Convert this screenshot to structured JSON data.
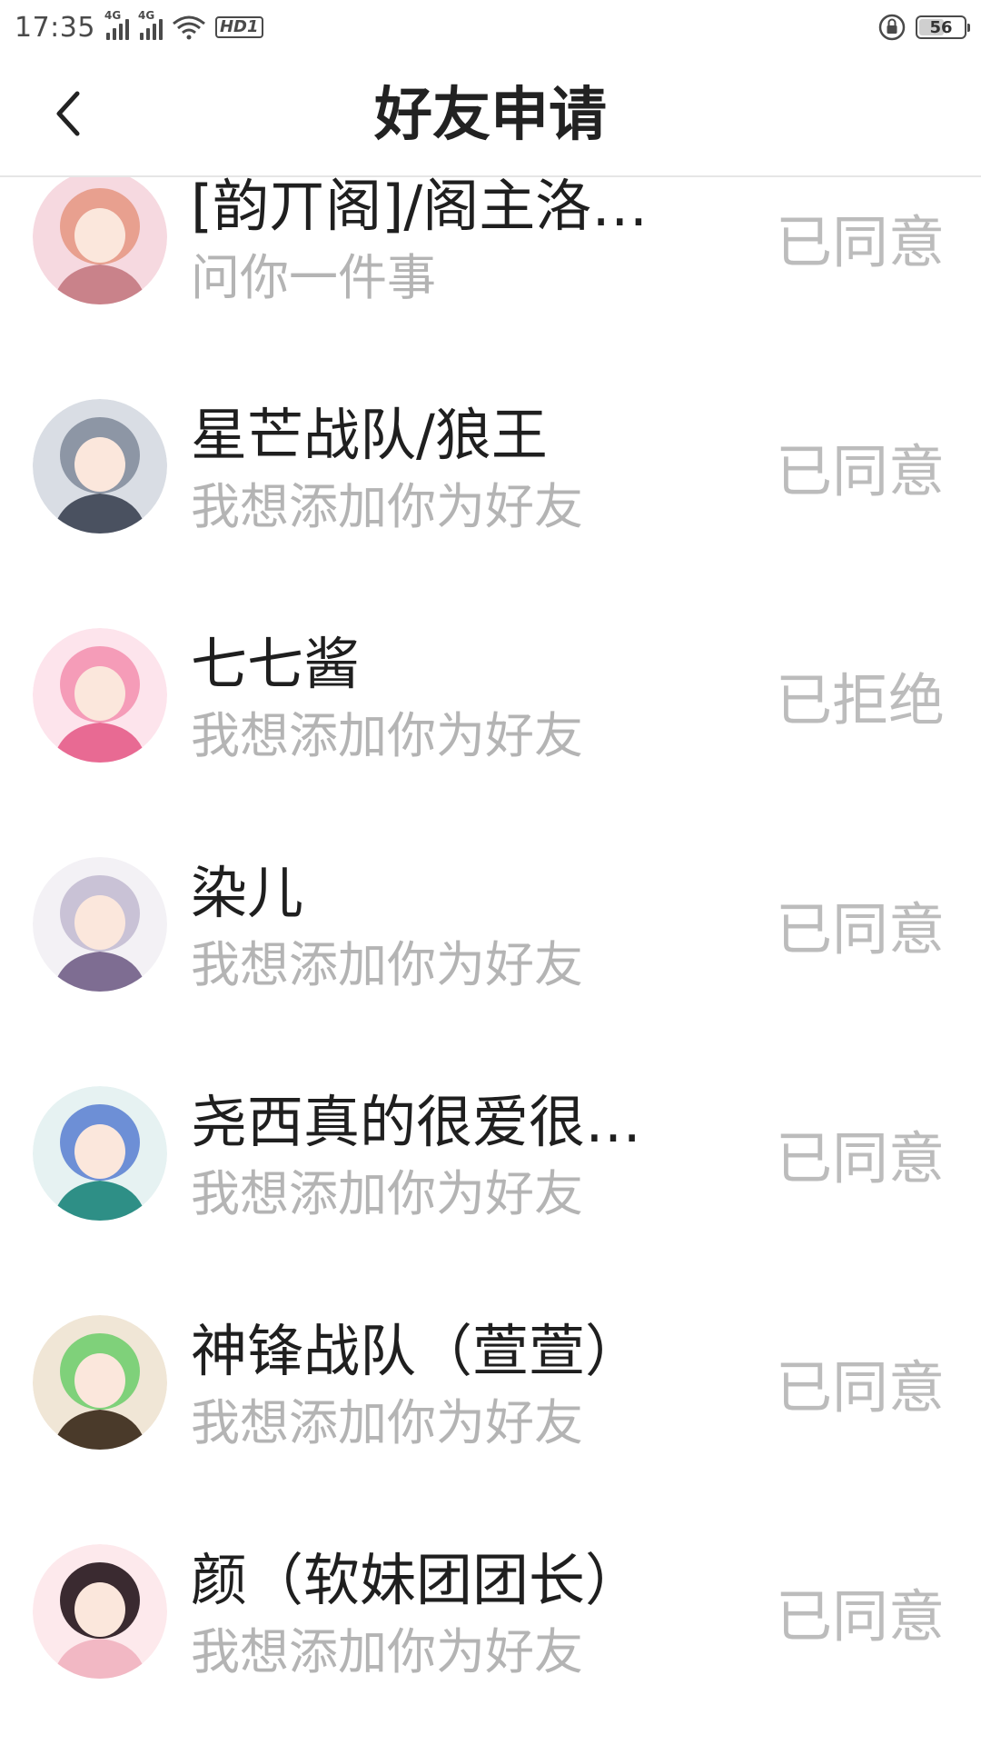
{
  "status_bar": {
    "time": "17:35",
    "network_1": "4G",
    "network_2": "4G",
    "hd_label": "HD1",
    "battery_level": "56",
    "battery_fraction": 0.56
  },
  "nav": {
    "title": "好友申请",
    "back_icon": "chevron-left-icon"
  },
  "requests": [
    {
      "name": "[韵丌阁]/阁主洛…",
      "message": "问你一件事",
      "status": "已同意",
      "avatar_colors": [
        "#f6d9e0",
        "#e8a08f",
        "#c9828a"
      ]
    },
    {
      "name": "星芒战队/狼王",
      "message": "我想添加你为好友",
      "status": "已同意",
      "avatar_colors": [
        "#d9dde4",
        "#8d96a5",
        "#4a5160"
      ]
    },
    {
      "name": "七七酱",
      "message": "我想添加你为好友",
      "status": "已拒绝",
      "avatar_colors": [
        "#fde4ec",
        "#f59cb8",
        "#e86a93"
      ]
    },
    {
      "name": "染儿",
      "message": "我想添加你为好友",
      "status": "已同意",
      "avatar_colors": [
        "#f3f1f5",
        "#c9c2d6",
        "#7e6d92"
      ]
    },
    {
      "name": "尧西真的很爱很…",
      "message": "我想添加你为好友",
      "status": "已同意",
      "avatar_colors": [
        "#e6f2f2",
        "#6d8fd6",
        "#2e8f86"
      ]
    },
    {
      "name": "神锋战队（萱萱）",
      "message": "我想添加你为好友",
      "status": "已同意",
      "avatar_colors": [
        "#f0e6d6",
        "#7fd17a",
        "#4a3a2a"
      ]
    },
    {
      "name": "颜（软妹团团长）",
      "message": "我想添加你为好友",
      "status": "已同意",
      "avatar_colors": [
        "#fde9ec",
        "#3a2a30",
        "#f2b8c4"
      ]
    }
  ]
}
